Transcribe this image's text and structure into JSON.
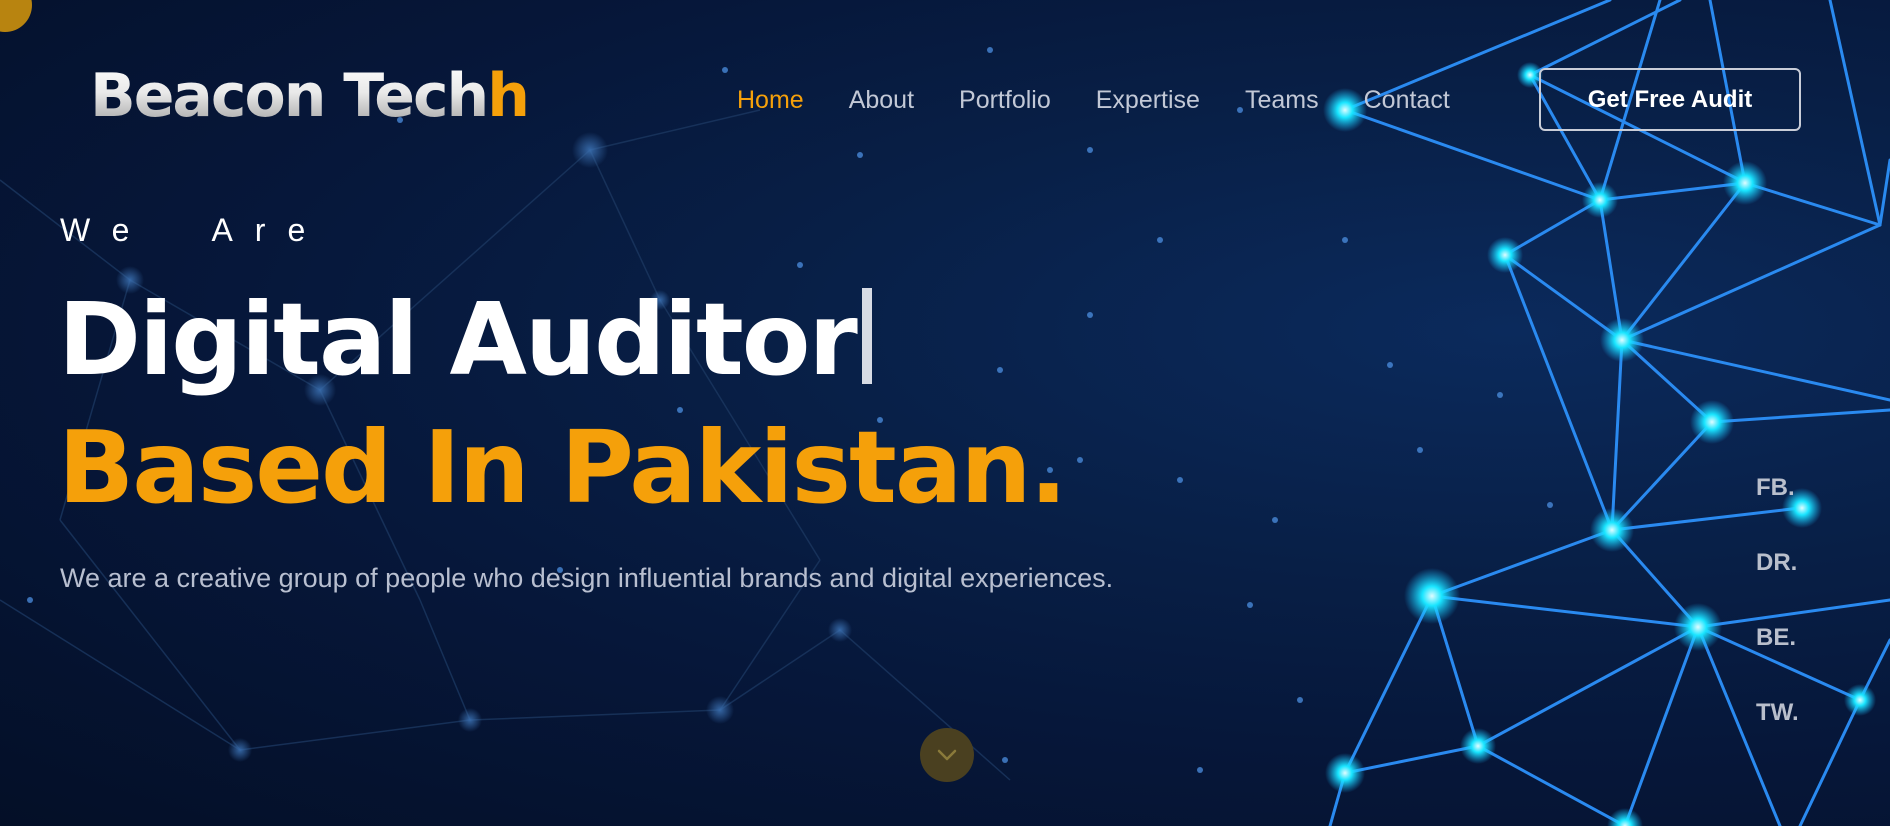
{
  "brand": {
    "logo_main": "Beacon Tech",
    "logo_accent": "h",
    "accent_color": "#f5a00a"
  },
  "nav": {
    "items": [
      {
        "label": "Home",
        "active": true
      },
      {
        "label": "About",
        "active": false
      },
      {
        "label": "Portfolio",
        "active": false
      },
      {
        "label": "Expertise",
        "active": false
      },
      {
        "label": "Teams",
        "active": false
      },
      {
        "label": "Contact",
        "active": false
      }
    ],
    "cta_label": "Get Free Audit"
  },
  "hero": {
    "eyebrow": "We  Are",
    "headline_line1": "Digital Auditor",
    "headline_line2": "Based In Pakistan.",
    "description": "We are a creative group of people who design influential brands and digital experiences."
  },
  "social": {
    "items": [
      "FB.",
      "DR.",
      "BE.",
      "TW."
    ]
  },
  "icons": {
    "scroll_down": "chevron-down-icon"
  }
}
